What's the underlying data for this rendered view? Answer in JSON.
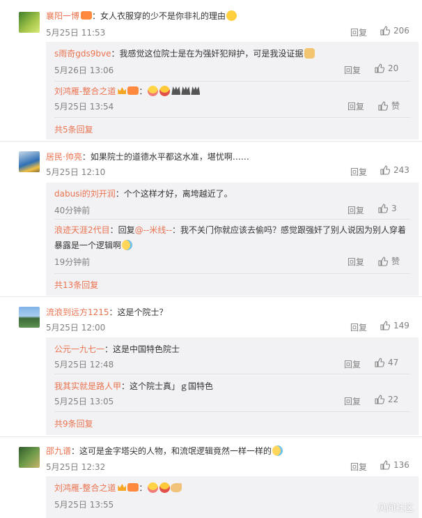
{
  "reply_label": "回复",
  "praise_label": "赞",
  "threads": [
    {
      "user": "襄阳一博",
      "text": "：女人衣服穿的少不是你非礼的理由",
      "time": "5月25日 11:53",
      "likes": "206",
      "subs": [
        {
          "user": "s雨奇gds9bve",
          "text": "：我感觉这位院士是在为强奸犯辩护，可是我没证据",
          "time": "5月26日 13:06",
          "likes": "20"
        },
        {
          "user": "刘鸿雁-整合之道",
          "text": "：",
          "time": "5月25日 13:54",
          "likes": ""
        }
      ],
      "more": "共5条回复"
    },
    {
      "user": "居民·帅亮",
      "text": "：如果院士的道德水平都这水准，堪忧啊……",
      "time": "5月25日 12:10",
      "likes": "243",
      "subs": [
        {
          "user": "dabusi的刘开润",
          "text": "：个个这样才好，离垮越近了。",
          "time": "40分钟前",
          "likes": "3"
        },
        {
          "user": "浪迹天涯2代目",
          "text_prefix": "：回复",
          "mention": "@--米线--",
          "text": "：我不关门你就应该去偷吗？感觉跟强奸了别人说因为别人穿着",
          "text2": "暴露是一个逻辑啊",
          "time": "19分钟前",
          "likes": ""
        }
      ],
      "more": "共13条回复"
    },
    {
      "user": "流浪到远方1215",
      "text": "：这是个院士？",
      "time": "5月25日 12:00",
      "likes": "149",
      "subs": [
        {
          "user": "公元一九七一",
          "text": "：这是中国特色院士",
          "time": "5月25日 12:48",
          "likes": "47"
        },
        {
          "user": "我其实就是路人甲",
          "text": "：这个院士真」ｇ国特色",
          "time": "5月25日 13:05",
          "likes": "22"
        }
      ],
      "more": "共9条回复"
    },
    {
      "user": "邵九谱",
      "text": "：这可是金字塔尖的人物，和流氓逻辑竟然一样一样的",
      "time": "5月25日 12:32",
      "likes": "136",
      "subs": [
        {
          "user": "刘鸿雁-整合之道",
          "text": "：",
          "time": "5月25日 13:55",
          "likes": ""
        }
      ],
      "more": ""
    }
  ],
  "watermark": "风闻社区",
  "icons": {
    "thumb": "thumb-up-icon"
  }
}
